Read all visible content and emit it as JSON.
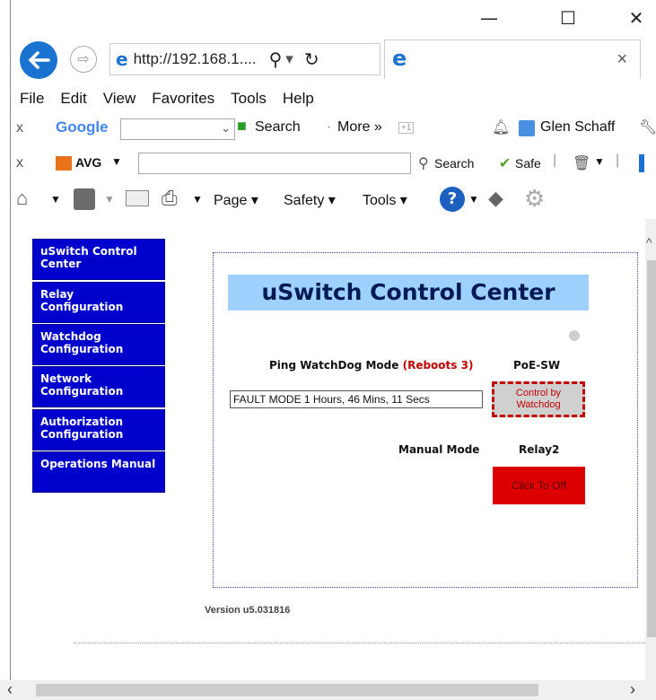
{
  "window": {
    "minimize": "—",
    "maximize": "☐",
    "close": "✕"
  },
  "address": {
    "url": "http://192.168.1....",
    "search_sep": "▾",
    "tab_close": "×"
  },
  "menu": [
    "File",
    "Edit",
    "View",
    "Favorites",
    "Tools",
    "Help"
  ],
  "google_bar": {
    "close": "x",
    "google": "Google",
    "search": "Search",
    "more": "More »",
    "plus": "+1",
    "user": "Glen Schaff"
  },
  "avg_bar": {
    "close": "x",
    "avg": "AVG",
    "search": "Search",
    "safe": "Safe"
  },
  "cmd_bar": {
    "page": "Page",
    "safety": "Safety",
    "tools": "Tools"
  },
  "nav": [
    {
      "label": "uSwitch Control Center"
    },
    {
      "label": "Relay Configuration"
    },
    {
      "label": "Watchdog Configuration"
    },
    {
      "label": "Network Configuration"
    },
    {
      "label": "Authorization Configuration"
    },
    {
      "label": "Operations Manual"
    }
  ],
  "panel": {
    "title": "uSwitch Control Center",
    "ping_label": "Ping WatchDog Mode",
    "reboots": "(Reboots 3)",
    "poe_label": "PoE-SW",
    "fault_text": "FAULT MODE 1 Hours, 46 Mins, 11 Secs",
    "control_btn": "Control by Watchdog",
    "manual_label": "Manual Mode",
    "relay2_label": "Relay2",
    "relay_btn": "Click To Off"
  },
  "version": "Version u5.031816",
  "colors": {
    "nav_bg": "#0000cc",
    "banner_bg": "#9fd1ff",
    "relay_btn": "#dd0000",
    "control_border": "#c00000"
  }
}
